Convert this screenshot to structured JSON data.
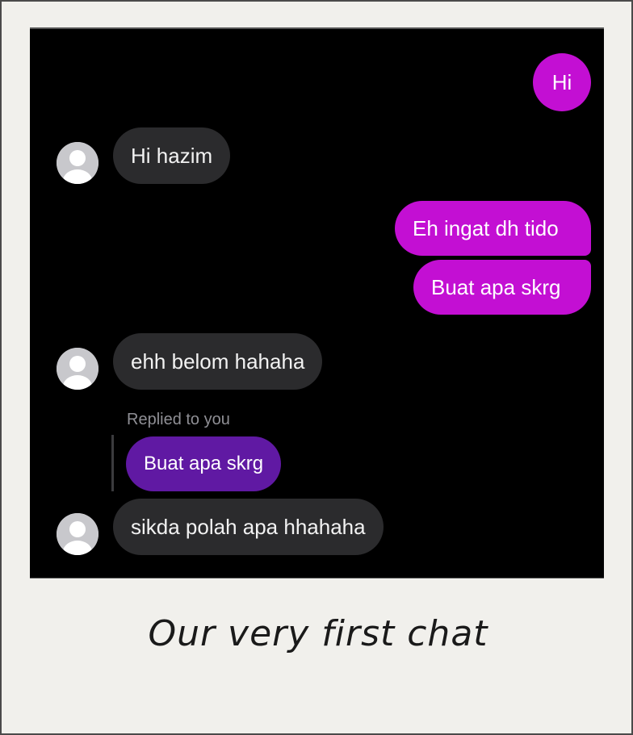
{
  "messages": [
    {
      "sender": "me",
      "text": "Hi"
    },
    {
      "sender": "contact",
      "text": "Hi hazim"
    },
    {
      "sender": "me",
      "text": "Eh ingat dh tido"
    },
    {
      "sender": "me",
      "text": "Buat apa skrg"
    },
    {
      "sender": "contact",
      "text": "ehh belom hahaha"
    },
    {
      "sender": "contact",
      "reply_label": "Replied to you",
      "quoted_text": "Buat apa skrg",
      "text": "sikda polah apa hhahaha"
    }
  ],
  "caption": "Our very first chat",
  "colors": {
    "sent_bubble": "#c30fd3",
    "received_bubble": "#2b2b2d",
    "reply_quote_bubble": "#6019a3",
    "chat_background": "#000000",
    "frame_background": "#f1f0ec"
  },
  "icons": {
    "avatar": "default-profile-avatar-icon"
  }
}
